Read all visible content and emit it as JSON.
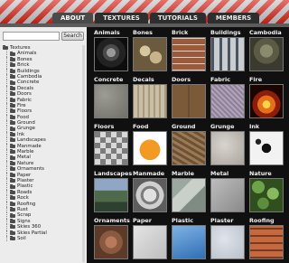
{
  "nav": {
    "tabs": [
      "ABOUT",
      "TEXTURES",
      "TUTORIALS",
      "MEMBERS"
    ],
    "active": "ABOUT"
  },
  "search": {
    "value": "",
    "button_label": "Search"
  },
  "sidebar": {
    "root_label": "Textures",
    "items": [
      "Animals",
      "Bones",
      "Brick",
      "Buildings",
      "Cambodia",
      "Concrete",
      "Decals",
      "Doors",
      "Fabric",
      "Fire",
      "Floors",
      "Food",
      "Ground",
      "Grunge",
      "Ink",
      "Landscapes",
      "Manmade",
      "Marble",
      "Metal",
      "Nature",
      "Ornaments",
      "Paper",
      "Plaster",
      "Plastic",
      "Roads",
      "Rock",
      "Roofing",
      "Rust",
      "Scrap",
      "Signs",
      "Skies 360",
      "Skies Partial",
      "Soil"
    ]
  },
  "categories": [
    {
      "label": "Animals",
      "icon": "gorilla-thumbnail"
    },
    {
      "label": "Bones",
      "icon": "skulls-thumbnail"
    },
    {
      "label": "Brick",
      "icon": "brick-wall-thumbnail"
    },
    {
      "label": "Buildings",
      "icon": "building-facade-thumbnail"
    },
    {
      "label": "Cambodia",
      "icon": "stone-carving-thumbnail"
    },
    {
      "label": "Concrete",
      "icon": "concrete-thumbnail"
    },
    {
      "label": "Decals",
      "icon": "decals-thumbnail"
    },
    {
      "label": "Doors",
      "icon": "doors-thumbnail"
    },
    {
      "label": "Fabric",
      "icon": "fabric-thumbnail"
    },
    {
      "label": "Fire",
      "icon": "fire-thumbnail"
    },
    {
      "label": "Floors",
      "icon": "floor-tiles-thumbnail"
    },
    {
      "label": "Food",
      "icon": "orange-thumbnail"
    },
    {
      "label": "Ground",
      "icon": "ground-thumbnail"
    },
    {
      "label": "Grunge",
      "icon": "grunge-thumbnail"
    },
    {
      "label": "Ink",
      "icon": "ink-splatter-thumbnail"
    },
    {
      "label": "Landscapes",
      "icon": "landscape-thumbnail"
    },
    {
      "label": "Manmade",
      "icon": "metal-dial-thumbnail"
    },
    {
      "label": "Marble",
      "icon": "marble-thumbnail"
    },
    {
      "label": "Metal",
      "icon": "metal-thumbnail"
    },
    {
      "label": "Nature",
      "icon": "leaves-thumbnail"
    },
    {
      "label": "Ornaments",
      "icon": "ornament-thumbnail"
    },
    {
      "label": "Paper",
      "icon": "paper-thumbnail"
    },
    {
      "label": "Plastic",
      "icon": "plastic-thumbnail"
    },
    {
      "label": "Plaster",
      "icon": "plaster-thumbnail"
    },
    {
      "label": "Roofing",
      "icon": "roof-tiles-thumbnail"
    }
  ]
}
